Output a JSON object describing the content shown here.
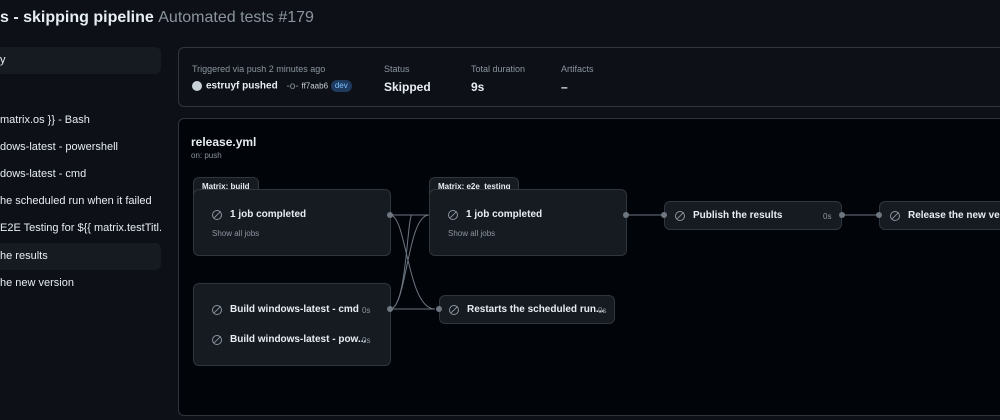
{
  "header": {
    "title": "s - skipping pipeline",
    "subtitle": "Automated tests #179"
  },
  "sidebar": {
    "items": [
      {
        "label": "y"
      },
      {
        "label": "matrix.os }} - Bash"
      },
      {
        "label": "dows-latest - powershell"
      },
      {
        "label": "dows-latest - cmd"
      },
      {
        "label": "he scheduled run when it failed"
      },
      {
        "label": "E2E Testing for ${{ matrix.testTitl..."
      },
      {
        "label": "he results"
      },
      {
        "label": "he new version"
      }
    ]
  },
  "summary": {
    "trigger_label": "Triggered via push 2 minutes ago",
    "actor": "estruyf pushed",
    "commit": "ff7aab6",
    "branch": "dev",
    "status_label": "Status",
    "status_value": "Skipped",
    "duration_label": "Total duration",
    "duration_value": "9s",
    "artifacts_label": "Artifacts",
    "artifacts_value": "–"
  },
  "graph": {
    "workflow_file": "release.yml",
    "trigger": "on: push",
    "matrix_build": {
      "label": "Matrix: build",
      "status": "1 job completed",
      "link": "Show all jobs"
    },
    "matrix_e2e": {
      "label": "Matrix: e2e_testing",
      "status": "1 job completed",
      "link": "Show all jobs"
    },
    "publish": {
      "label": "Publish the results",
      "duration": "0s"
    },
    "release": {
      "label": "Release the new versi"
    },
    "build_cmd": {
      "label": "Build windows-latest - cmd",
      "duration": "0s"
    },
    "build_pow": {
      "label": "Build windows-latest - pow...",
      "duration": "0s"
    },
    "restarts": {
      "label": "Restarts the scheduled run...",
      "duration": "0s"
    }
  },
  "colors": {
    "background": "#0d1117",
    "panel": "#161b22",
    "border": "#30363d",
    "muted_text": "#8b949e",
    "branch_badge": "#1f3a5f"
  }
}
